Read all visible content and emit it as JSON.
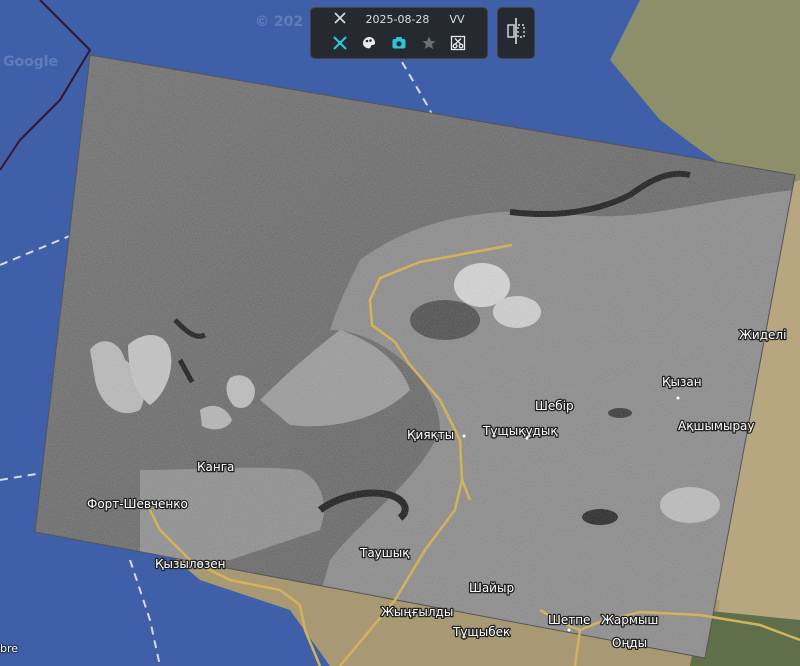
{
  "watermarks": {
    "copyright": "© 202",
    "google": "Google"
  },
  "toolbar": {
    "tool_icon": "tools-icon",
    "date": "2025-08-28",
    "polarization": "VV",
    "buttons": [
      {
        "icon": "satellite-tool-icon",
        "color": "#2ec4d6"
      },
      {
        "icon": "palette-icon",
        "color": "#e8ecf0"
      },
      {
        "icon": "camera-icon",
        "color": "#2ec4d6"
      },
      {
        "icon": "star-icon",
        "color": "#6a6f78"
      },
      {
        "icon": "scissors-icon",
        "color": "#e8ecf0"
      }
    ]
  },
  "compare_button": {
    "icon": "compare-split-icon"
  },
  "places": [
    {
      "name": "Жиделі"
    },
    {
      "name": "Қызан"
    },
    {
      "name": "Шебір"
    },
    {
      "name": "Ақшымырау"
    },
    {
      "name": "Қияқты"
    },
    {
      "name": "Тұщықұдық"
    },
    {
      "name": "Канга"
    },
    {
      "name": "Форт-Шевченко"
    },
    {
      "name": "Таушық"
    },
    {
      "name": "Қызылөзен"
    },
    {
      "name": "Шайыр"
    },
    {
      "name": "Жыңғылды"
    },
    {
      "name": "Шетпе"
    },
    {
      "name": "Жармыш"
    },
    {
      "name": "Тұщыбек"
    },
    {
      "name": "Оңды"
    }
  ],
  "corner_text": "bre",
  "colors": {
    "sea": "#3f5fa9",
    "toolbar_bg": "#262a30",
    "accent": "#2ec4d6",
    "road": "#d2b25a"
  }
}
